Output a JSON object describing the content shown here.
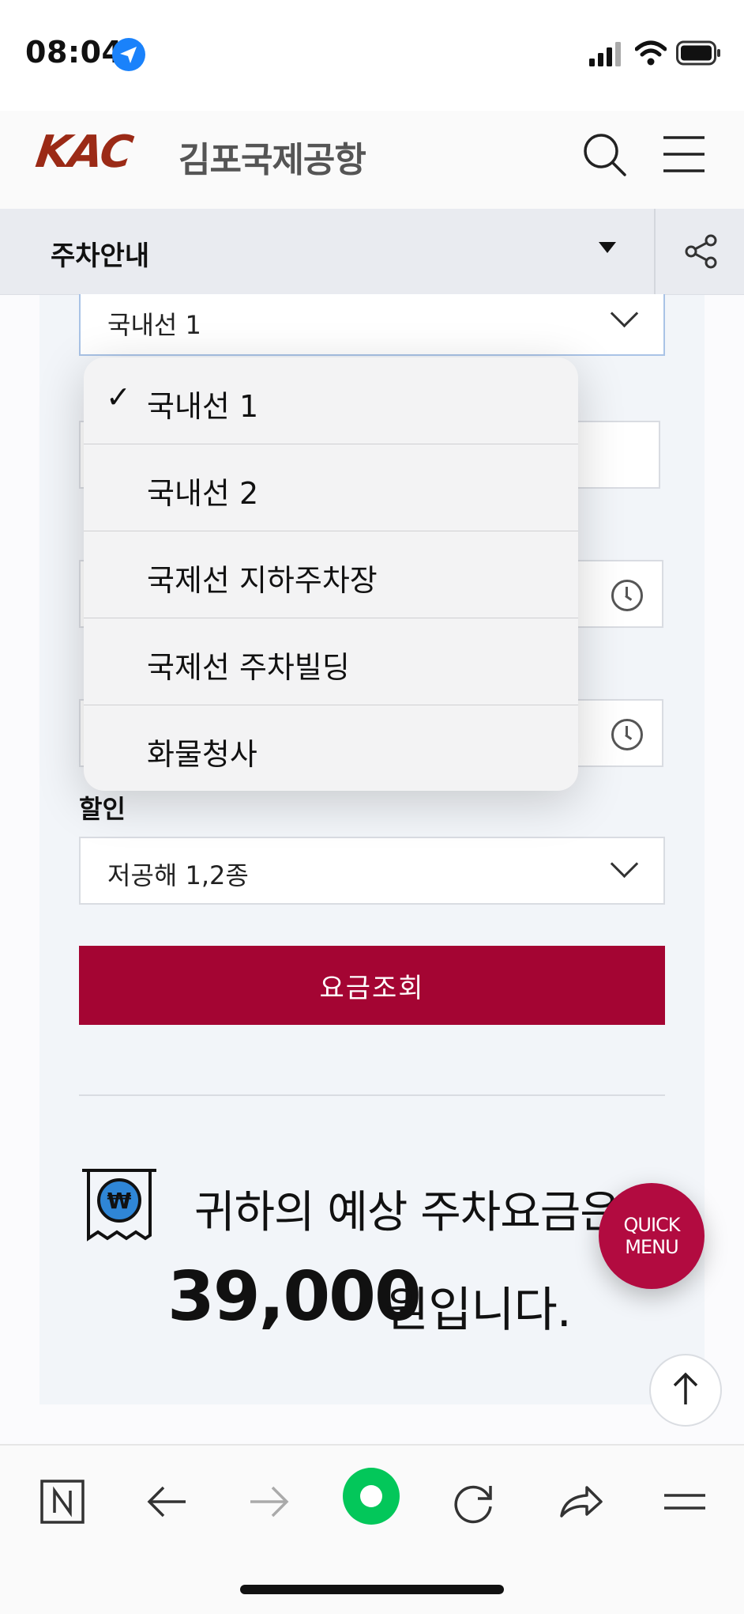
{
  "status_bar": {
    "time": "08:04"
  },
  "header": {
    "logo_text": "KAC",
    "site_name": "김포국제공항"
  },
  "subnav": {
    "title": "주차안내"
  },
  "form": {
    "lot_select": {
      "value": "국내선 1"
    },
    "discount": {
      "label": "할인",
      "value": "저공해 1,2종"
    },
    "search_button": "요금조회"
  },
  "result": {
    "line1": "귀하의 예상 주차요금은",
    "amount": "39,000",
    "amount_suffix": "원입니다."
  },
  "dropdown": {
    "selected_index": 0,
    "options": [
      {
        "label": "국내선 1",
        "selected": true
      },
      {
        "label": "국내선 2",
        "selected": false
      },
      {
        "label": "국제선 지하주차장",
        "selected": false
      },
      {
        "label": "국제선 주차빌딩",
        "selected": false
      },
      {
        "label": "화물청사",
        "selected": false
      }
    ]
  },
  "quick_menu": {
    "line1": "QUICK",
    "line2": "MENU"
  },
  "colors": {
    "accent": "#a40533",
    "logo": "#9b2a16",
    "naver_green": "#03c75a"
  },
  "toolbar_icons": [
    "naver-n-icon",
    "back-arrow-icon",
    "forward-arrow-icon",
    "naver-home-icon",
    "reload-icon",
    "share-icon",
    "menu-icon"
  ]
}
